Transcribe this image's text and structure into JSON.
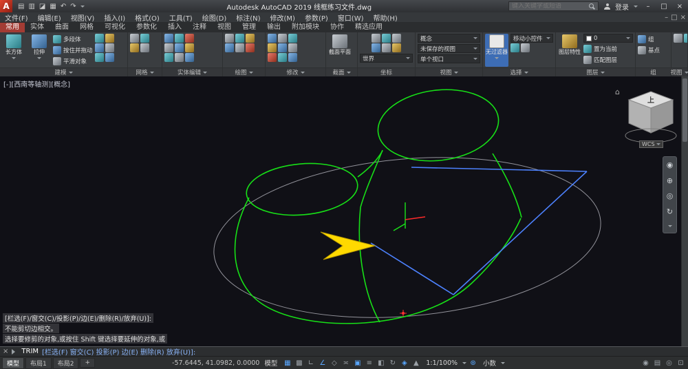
{
  "ui": {
    "minimize": "–",
    "maximize": "□",
    "close": "×"
  },
  "titlebar": {
    "title": "Autodesk AutoCAD 2019  线框练习文件.dwg",
    "search_placeholder": "键入关键字或短语",
    "signin_label": "登录",
    "qat_icons": [
      {
        "name": "new-icon",
        "glyph": "▤"
      },
      {
        "name": "open-icon",
        "glyph": "▥"
      },
      {
        "name": "save-icon",
        "glyph": "◪"
      },
      {
        "name": "plot-icon",
        "glyph": "▦"
      },
      {
        "name": "undo-icon",
        "glyph": "↶"
      },
      {
        "name": "redo-icon",
        "glyph": "↷"
      }
    ]
  },
  "menubar": {
    "items": [
      "文件(F)",
      "编辑(E)",
      "视图(V)",
      "插入(I)",
      "格式(O)",
      "工具(T)",
      "绘图(D)",
      "标注(N)",
      "修改(M)",
      "参数(P)",
      "窗口(W)",
      "帮助(H)"
    ]
  },
  "ribbon": {
    "tabs": [
      "常用",
      "实体",
      "曲面",
      "网格",
      "可视化",
      "参数化",
      "插入",
      "注释",
      "视图",
      "管理",
      "输出",
      "附加模块",
      "协作",
      "精选应用"
    ],
    "panels": {
      "modeling": {
        "label": "建模",
        "box": "长方体",
        "extrude": "拉伸",
        "polysolid": "多段体",
        "presspull": "按住并拖动",
        "smooth": "平滑对象"
      },
      "mesh": {
        "label": "网格"
      },
      "solid_editing": {
        "label": "实体编辑"
      },
      "draw": {
        "label": "绘图"
      },
      "modify": {
        "label": "修改"
      },
      "section": {
        "label": "截面",
        "plane": "截面平面"
      },
      "coordinates": {
        "label": "坐标",
        "ucs": "世界"
      },
      "view": {
        "label": "视图",
        "visual_style": "概念",
        "named_view": "未保存的视图",
        "viewport": "单个视口"
      },
      "selection": {
        "label": "选择",
        "filter": "无过滤器",
        "gizmo": "移动小控件"
      },
      "layers": {
        "label": "图层",
        "properties": "图层特性",
        "current": "0",
        "make_current": "置为当前",
        "match": "匹配图层"
      },
      "groups": {
        "label": "组",
        "group": "组",
        "basepoint": "基点"
      },
      "view2": {
        "label": "视图"
      }
    }
  },
  "canvas": {
    "viewport_label": "[-][西南等轴测][概念]",
    "viewcube_home": "⌂",
    "viewcube_top": "上",
    "viewcube_wcs": "WCS",
    "navbar_icons": [
      {
        "name": "steering-wheel-icon",
        "glyph": "◉"
      },
      {
        "name": "pan-icon",
        "glyph": "⊕"
      },
      {
        "name": "zoom-icon",
        "glyph": "◎"
      },
      {
        "name": "orbit-icon",
        "glyph": "↻"
      }
    ],
    "history_line1": "[栏选(F)/窗交(C)/投影(P)/边(E)/删除(R)/放弃(U)]:",
    "history_line2": "不能剪切边相交。",
    "history_line3": "选择要修剪的对象,或按住 Shift 键选择要延伸的对象,或",
    "colors": {
      "wire": "#17e017",
      "edge": "#4d82ff",
      "arrow": "#ffd900",
      "construction": "#93939b"
    }
  },
  "command": {
    "name": "TRIM",
    "options": "[栏选(F) 窗交(C) 投影(P) 边(E) 删除(R) 放弃(U)]:"
  },
  "layout_tabs": {
    "model": "模型",
    "layout1": "布局1",
    "layout2": "布局2",
    "add": "+"
  },
  "statusbar": {
    "coords": "-57.6445, 41.0982, 0.0000",
    "model_toggle": "模型",
    "icons": [
      {
        "name": "grid-icon",
        "glyph": "▦"
      },
      {
        "name": "snap-icon",
        "glyph": "▩"
      },
      {
        "name": "ortho-icon",
        "glyph": "∟"
      },
      {
        "name": "polar-icon",
        "glyph": "∠"
      },
      {
        "name": "isodraft-icon",
        "glyph": "◇"
      },
      {
        "name": "otrack-icon",
        "glyph": "≍"
      },
      {
        "name": "osnap-icon",
        "glyph": "▣"
      },
      {
        "name": "lineweight-icon",
        "glyph": "≡"
      },
      {
        "name": "transparency-icon",
        "glyph": "◧"
      },
      {
        "name": "selection-cycling-icon",
        "glyph": "↻"
      },
      {
        "name": "gizmo-icon",
        "glyph": "◈"
      },
      {
        "name": "annotation-icon",
        "glyph": "▲"
      }
    ],
    "scale": "1:1/100%",
    "workspace_icon": "⊛",
    "precision": "小数",
    "right_icons": [
      {
        "name": "annotation-monitor-icon",
        "glyph": "◉"
      },
      {
        "name": "quick-properties-icon",
        "glyph": "▤"
      },
      {
        "name": "isolate-objects-icon",
        "glyph": "◎"
      },
      {
        "name": "fullscreen-icon",
        "glyph": "⊡"
      }
    ]
  }
}
